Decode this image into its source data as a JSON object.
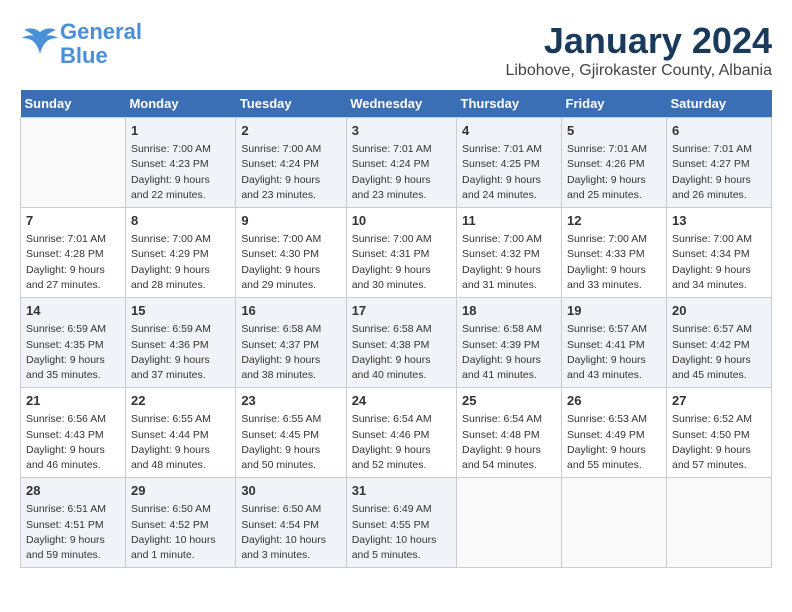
{
  "header": {
    "logo_line1": "General",
    "logo_line2": "Blue",
    "title": "January 2024",
    "subtitle": "Libohove, Gjirokaster County, Albania"
  },
  "days_of_week": [
    "Sunday",
    "Monday",
    "Tuesday",
    "Wednesday",
    "Thursday",
    "Friday",
    "Saturday"
  ],
  "weeks": [
    [
      {
        "day": "",
        "info": ""
      },
      {
        "day": "1",
        "info": "Sunrise: 7:00 AM\nSunset: 4:23 PM\nDaylight: 9 hours\nand 22 minutes."
      },
      {
        "day": "2",
        "info": "Sunrise: 7:00 AM\nSunset: 4:24 PM\nDaylight: 9 hours\nand 23 minutes."
      },
      {
        "day": "3",
        "info": "Sunrise: 7:01 AM\nSunset: 4:24 PM\nDaylight: 9 hours\nand 23 minutes."
      },
      {
        "day": "4",
        "info": "Sunrise: 7:01 AM\nSunset: 4:25 PM\nDaylight: 9 hours\nand 24 minutes."
      },
      {
        "day": "5",
        "info": "Sunrise: 7:01 AM\nSunset: 4:26 PM\nDaylight: 9 hours\nand 25 minutes."
      },
      {
        "day": "6",
        "info": "Sunrise: 7:01 AM\nSunset: 4:27 PM\nDaylight: 9 hours\nand 26 minutes."
      }
    ],
    [
      {
        "day": "7",
        "info": "Sunrise: 7:01 AM\nSunset: 4:28 PM\nDaylight: 9 hours\nand 27 minutes."
      },
      {
        "day": "8",
        "info": "Sunrise: 7:00 AM\nSunset: 4:29 PM\nDaylight: 9 hours\nand 28 minutes."
      },
      {
        "day": "9",
        "info": "Sunrise: 7:00 AM\nSunset: 4:30 PM\nDaylight: 9 hours\nand 29 minutes."
      },
      {
        "day": "10",
        "info": "Sunrise: 7:00 AM\nSunset: 4:31 PM\nDaylight: 9 hours\nand 30 minutes."
      },
      {
        "day": "11",
        "info": "Sunrise: 7:00 AM\nSunset: 4:32 PM\nDaylight: 9 hours\nand 31 minutes."
      },
      {
        "day": "12",
        "info": "Sunrise: 7:00 AM\nSunset: 4:33 PM\nDaylight: 9 hours\nand 33 minutes."
      },
      {
        "day": "13",
        "info": "Sunrise: 7:00 AM\nSunset: 4:34 PM\nDaylight: 9 hours\nand 34 minutes."
      }
    ],
    [
      {
        "day": "14",
        "info": "Sunrise: 6:59 AM\nSunset: 4:35 PM\nDaylight: 9 hours\nand 35 minutes."
      },
      {
        "day": "15",
        "info": "Sunrise: 6:59 AM\nSunset: 4:36 PM\nDaylight: 9 hours\nand 37 minutes."
      },
      {
        "day": "16",
        "info": "Sunrise: 6:58 AM\nSunset: 4:37 PM\nDaylight: 9 hours\nand 38 minutes."
      },
      {
        "day": "17",
        "info": "Sunrise: 6:58 AM\nSunset: 4:38 PM\nDaylight: 9 hours\nand 40 minutes."
      },
      {
        "day": "18",
        "info": "Sunrise: 6:58 AM\nSunset: 4:39 PM\nDaylight: 9 hours\nand 41 minutes."
      },
      {
        "day": "19",
        "info": "Sunrise: 6:57 AM\nSunset: 4:41 PM\nDaylight: 9 hours\nand 43 minutes."
      },
      {
        "day": "20",
        "info": "Sunrise: 6:57 AM\nSunset: 4:42 PM\nDaylight: 9 hours\nand 45 minutes."
      }
    ],
    [
      {
        "day": "21",
        "info": "Sunrise: 6:56 AM\nSunset: 4:43 PM\nDaylight: 9 hours\nand 46 minutes."
      },
      {
        "day": "22",
        "info": "Sunrise: 6:55 AM\nSunset: 4:44 PM\nDaylight: 9 hours\nand 48 minutes."
      },
      {
        "day": "23",
        "info": "Sunrise: 6:55 AM\nSunset: 4:45 PM\nDaylight: 9 hours\nand 50 minutes."
      },
      {
        "day": "24",
        "info": "Sunrise: 6:54 AM\nSunset: 4:46 PM\nDaylight: 9 hours\nand 52 minutes."
      },
      {
        "day": "25",
        "info": "Sunrise: 6:54 AM\nSunset: 4:48 PM\nDaylight: 9 hours\nand 54 minutes."
      },
      {
        "day": "26",
        "info": "Sunrise: 6:53 AM\nSunset: 4:49 PM\nDaylight: 9 hours\nand 55 minutes."
      },
      {
        "day": "27",
        "info": "Sunrise: 6:52 AM\nSunset: 4:50 PM\nDaylight: 9 hours\nand 57 minutes."
      }
    ],
    [
      {
        "day": "28",
        "info": "Sunrise: 6:51 AM\nSunset: 4:51 PM\nDaylight: 9 hours\nand 59 minutes."
      },
      {
        "day": "29",
        "info": "Sunrise: 6:50 AM\nSunset: 4:52 PM\nDaylight: 10 hours\nand 1 minute."
      },
      {
        "day": "30",
        "info": "Sunrise: 6:50 AM\nSunset: 4:54 PM\nDaylight: 10 hours\nand 3 minutes."
      },
      {
        "day": "31",
        "info": "Sunrise: 6:49 AM\nSunset: 4:55 PM\nDaylight: 10 hours\nand 5 minutes."
      },
      {
        "day": "",
        "info": ""
      },
      {
        "day": "",
        "info": ""
      },
      {
        "day": "",
        "info": ""
      }
    ]
  ]
}
